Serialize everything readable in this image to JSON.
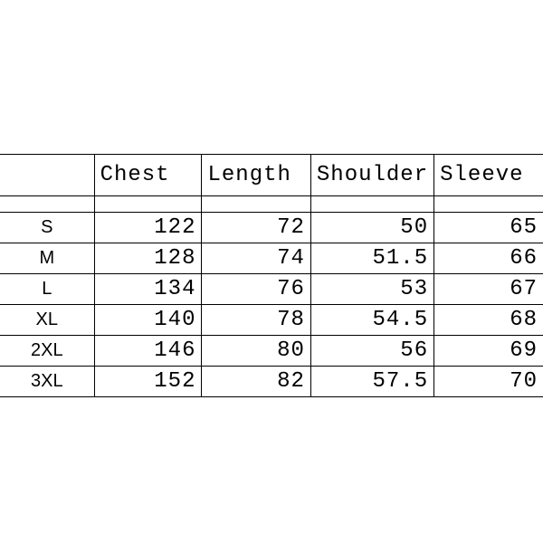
{
  "chart_data": {
    "type": "table",
    "title": "",
    "columns": [
      "",
      "Chest",
      "Length",
      "Shoulder",
      "Sleeve"
    ],
    "rows": [
      {
        "size": "S",
        "chest": 122,
        "length": 72,
        "shoulder": 50,
        "sleeve": 65
      },
      {
        "size": "M",
        "chest": 128,
        "length": 74,
        "shoulder": 51.5,
        "sleeve": 66
      },
      {
        "size": "L",
        "chest": 134,
        "length": 76,
        "shoulder": 53,
        "sleeve": 67
      },
      {
        "size": "XL",
        "chest": 140,
        "length": 78,
        "shoulder": 54.5,
        "sleeve": 68
      },
      {
        "size": "2XL",
        "chest": 146,
        "length": 80,
        "shoulder": 56,
        "sleeve": 69
      },
      {
        "size": "3XL",
        "chest": 152,
        "length": 82,
        "shoulder": 57.5,
        "sleeve": 70
      }
    ]
  }
}
